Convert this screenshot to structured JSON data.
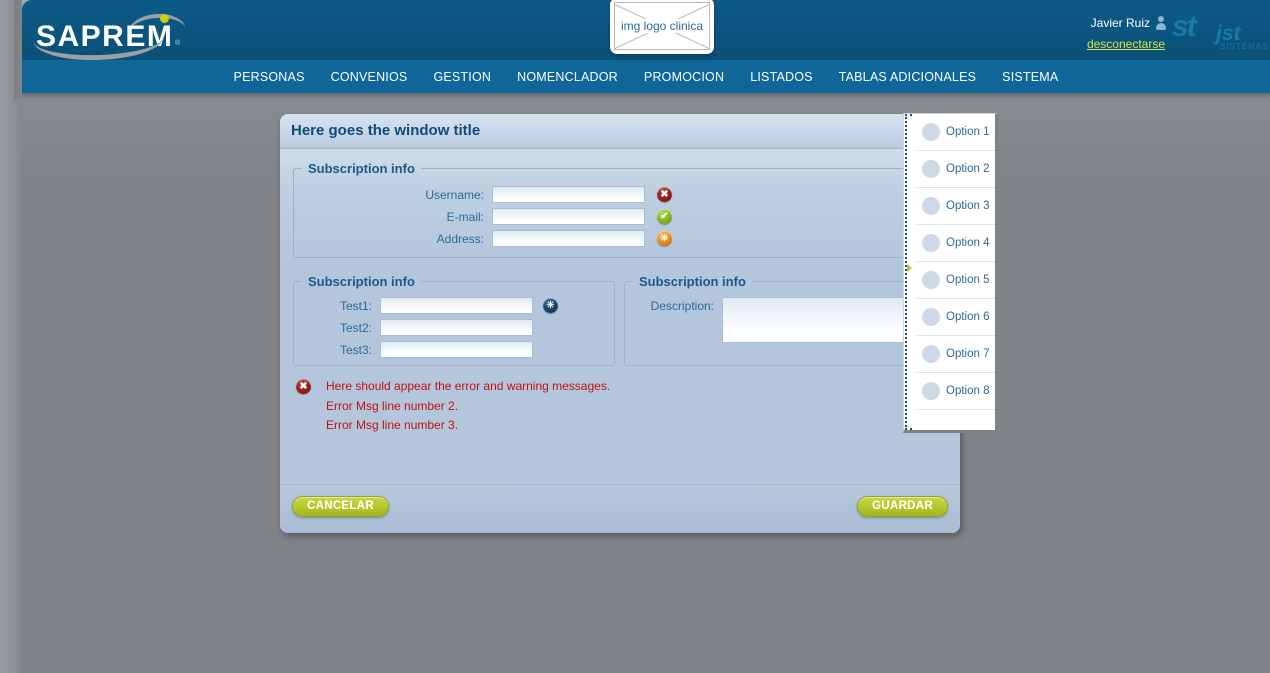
{
  "header": {
    "brand_name": "SAPREM",
    "brand_reg": "®",
    "clinic_logo_alt": "img logo clinica",
    "user_name": "Javier Ruiz",
    "logout_label": "desconectarse",
    "partner_mark": "st",
    "partner_name": "jst",
    "partner_sub": "SISTEMAS",
    "colors": {
      "header_blue": "#0a5682",
      "nav_blue": "#0f6699",
      "logout_green": "#d4e34a",
      "page_gray": "#808388"
    }
  },
  "nav": {
    "items": [
      {
        "label": "PERSONAS"
      },
      {
        "label": "CONVENIOS"
      },
      {
        "label": "GESTION"
      },
      {
        "label": "NOMENCLADOR"
      },
      {
        "label": "PROMOCION"
      },
      {
        "label": "LISTADOS"
      },
      {
        "label": "TABLAS ADICIONALES"
      },
      {
        "label": "SISTEMA"
      }
    ]
  },
  "window": {
    "title": "Here goes the window title",
    "fieldset_main": {
      "legend": "Subscription info",
      "fields": [
        {
          "label": "Username:",
          "value": "",
          "placeholder": "",
          "status": "error",
          "status_glyph": "✖"
        },
        {
          "label": "E-mail:",
          "value": "",
          "placeholder": "",
          "status": "ok",
          "status_glyph": "✔"
        },
        {
          "label": "Address:",
          "value": "",
          "placeholder": "",
          "status": "warning",
          "status_glyph": "✳"
        }
      ]
    },
    "fieldset_left": {
      "legend": "Subscription info",
      "fields": [
        {
          "label": "Test1:",
          "value": "",
          "placeholder": "",
          "status": "info",
          "status_glyph": "✳"
        },
        {
          "label": "Test2:",
          "value": "",
          "placeholder": "",
          "status": "none",
          "status_glyph": ""
        },
        {
          "label": "Test3:",
          "value": "",
          "placeholder": "",
          "status": "none",
          "status_glyph": ""
        }
      ]
    },
    "fieldset_right": {
      "legend": "Subscription info",
      "description_label": "Description:",
      "description_value": "",
      "description_placeholder": ""
    },
    "errors": {
      "icon_glyph": "✖",
      "lines": [
        "Here should appear the error and warning messages.",
        "Error Msg line number 2.",
        "Error Msg line number 3."
      ],
      "color": "#c01111"
    },
    "footer": {
      "cancel_label": "CANCELAR",
      "save_label": "GUARDAR"
    }
  },
  "options_panel": {
    "options": [
      {
        "label": "Option 1"
      },
      {
        "label": "Option 2"
      },
      {
        "label": "Option 3"
      },
      {
        "label": "Option 4"
      },
      {
        "label": "Option 5"
      },
      {
        "label": "Option 6"
      },
      {
        "label": "Option 7"
      },
      {
        "label": "Option 8"
      }
    ]
  }
}
